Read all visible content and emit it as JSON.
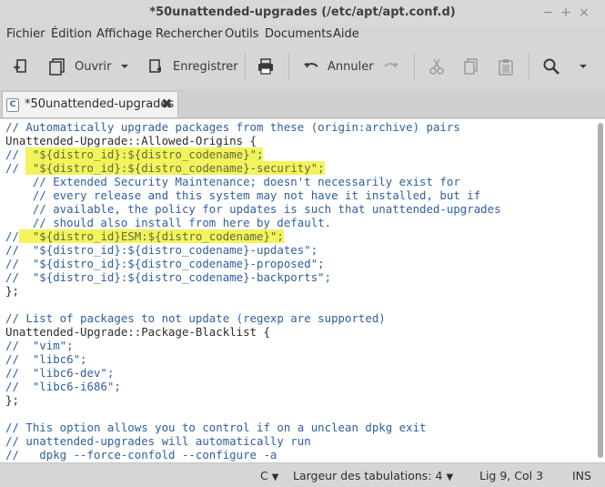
{
  "window": {
    "title": "*50unattended-upgrades (/etc/apt/apt.conf.d)",
    "minimize": "−",
    "maximize": "+",
    "close": "×"
  },
  "menu": [
    "Fichier",
    "Édition",
    "Affichage",
    "Rechercher",
    "Outils",
    "Documents",
    "Aide"
  ],
  "toolbar": {
    "open_label": "Ouvrir",
    "save_label": "Enregistrer",
    "undo_label": "Annuler"
  },
  "tab": {
    "icon_letter": "C",
    "label": "*50unattended-upgrades",
    "close": "✖"
  },
  "code_lines": [
    [
      [
        "c",
        "// Automatically upgrade packages from these (origin:archive) pairs"
      ]
    ],
    [
      [
        "p",
        "Unattended-Upgrade::Allowed-Origins {"
      ]
    ],
    [
      [
        "c",
        "// "
      ],
      [
        "h",
        " \"${distro_id}:${distro_codename}\";"
      ]
    ],
    [
      [
        "c",
        "// "
      ],
      [
        "h",
        " \"${distro_id}:${distro_codename}-security\";"
      ]
    ],
    [
      [
        "c",
        "    // Extended Security Maintenance; doesn't necessarily exist for"
      ]
    ],
    [
      [
        "c",
        "    // every release and this system may not have it installed, but if"
      ]
    ],
    [
      [
        "c",
        "    // available, the policy for updates is such that unattended-upgrades"
      ]
    ],
    [
      [
        "c",
        "    // should also install from here by default."
      ]
    ],
    [
      [
        "c",
        "//"
      ],
      [
        "h",
        "  \"${distro_id}ESM:${distro_codename}\";"
      ]
    ],
    [
      [
        "c",
        "//  \"${distro_id}:${distro_codename}-updates\";"
      ]
    ],
    [
      [
        "c",
        "//  \"${distro_id}:${distro_codename}-proposed\";"
      ]
    ],
    [
      [
        "c",
        "//  \"${distro_id}:${distro_codename}-backports\";"
      ]
    ],
    [
      [
        "p",
        "};"
      ]
    ],
    [
      [
        "p",
        ""
      ]
    ],
    [
      [
        "c",
        "// List of packages to not update (regexp are supported)"
      ]
    ],
    [
      [
        "p",
        "Unattended-Upgrade::Package-Blacklist {"
      ]
    ],
    [
      [
        "c",
        "//  \"vim\";"
      ]
    ],
    [
      [
        "c",
        "//  \"libc6\";"
      ]
    ],
    [
      [
        "c",
        "//  \"libc6-dev\";"
      ]
    ],
    [
      [
        "c",
        "//  \"libc6-i686\";"
      ]
    ],
    [
      [
        "p",
        "};"
      ]
    ],
    [
      [
        "p",
        ""
      ]
    ],
    [
      [
        "c",
        "// This option allows you to control if on a unclean dpkg exit"
      ]
    ],
    [
      [
        "c",
        "// unattended-upgrades will automatically run"
      ]
    ],
    [
      [
        "c",
        "//   dpkg --force-confold --configure -a"
      ]
    ]
  ],
  "status": {
    "language": "C",
    "tab_width_label": "Largeur des tabulations:",
    "tab_width_value": "4",
    "position": "Lig 9, Col 3",
    "mode": "INS"
  },
  "colors": {
    "highlight": "#f3f35c",
    "comment": "#2f5f9e"
  }
}
